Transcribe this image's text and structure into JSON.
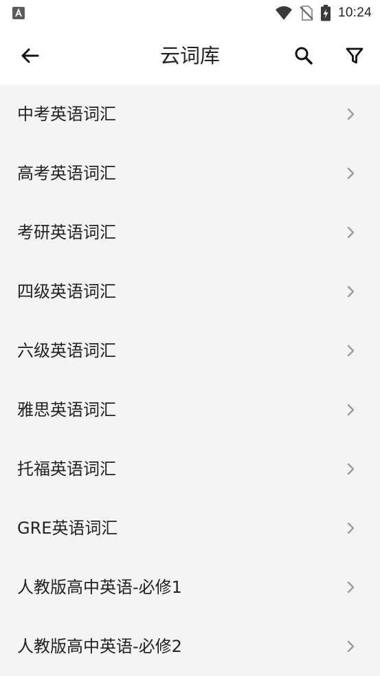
{
  "status_bar": {
    "time": "10:24",
    "icons": [
      "notification-a-icon",
      "wifi-icon",
      "no-sim-icon",
      "battery-charging-icon"
    ]
  },
  "app_bar": {
    "title": "云词库",
    "icons": [
      "back-arrow-icon",
      "search-icon",
      "filter-icon"
    ]
  },
  "word_banks": [
    {
      "label": "中考英语词汇"
    },
    {
      "label": "高考英语词汇"
    },
    {
      "label": "考研英语词汇"
    },
    {
      "label": "四级英语词汇"
    },
    {
      "label": "六级英语词汇"
    },
    {
      "label": "雅思英语词汇"
    },
    {
      "label": "托福英语词汇"
    },
    {
      "label": "GRE英语词汇"
    },
    {
      "label": "人教版高中英语-必修1"
    },
    {
      "label": "人教版高中英语-必修2"
    }
  ],
  "colors": {
    "bar_background": "#ffffff",
    "list_background": "#f4f4f4",
    "text": "#222222",
    "chevron": "#9e9e9e"
  }
}
